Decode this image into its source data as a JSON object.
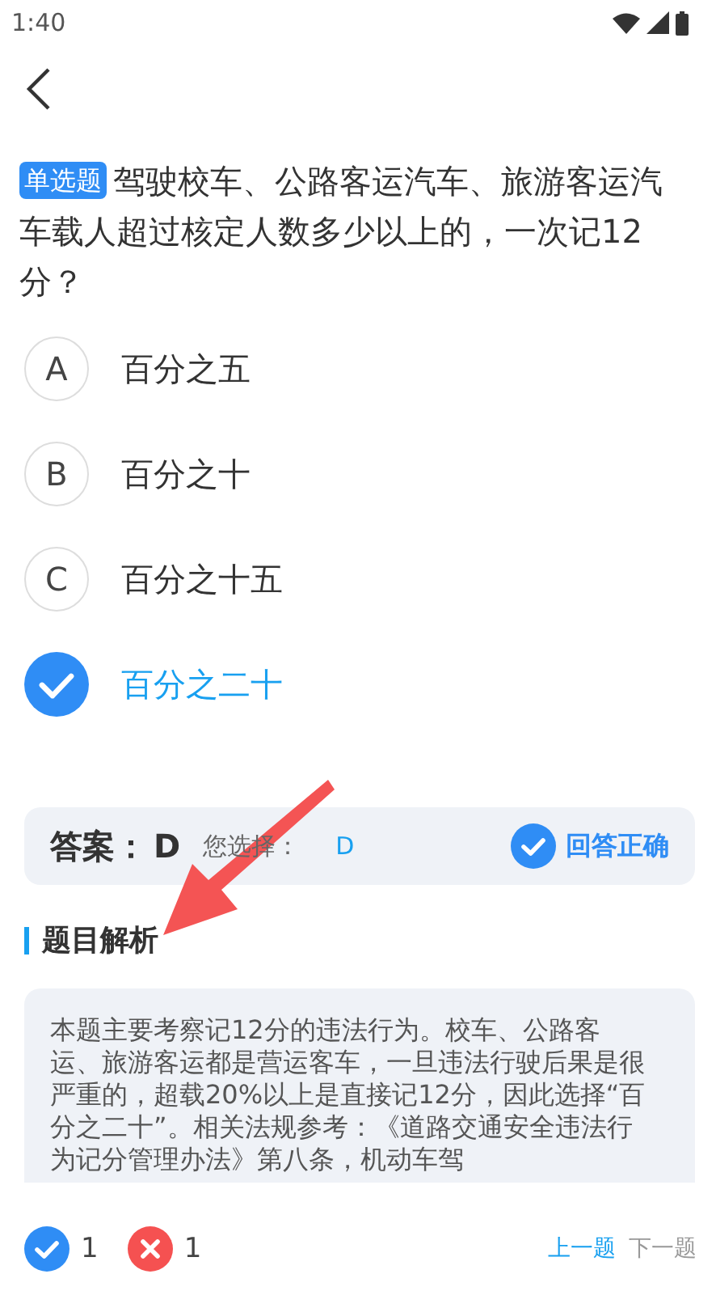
{
  "status_bar": {
    "time": "1:40"
  },
  "question": {
    "type_badge": "单选题",
    "text": "驾驶校车、公路客运汽车、旅游客运汽车载人超过核定人数多少以上的，一次记12分？"
  },
  "options": [
    {
      "letter": "A",
      "text": "百分之五",
      "selected": false
    },
    {
      "letter": "B",
      "text": "百分之十",
      "selected": false
    },
    {
      "letter": "C",
      "text": "百分之十五",
      "selected": false
    },
    {
      "text": "百分之二十",
      "selected": true
    }
  ],
  "answer": {
    "label": "答案：",
    "value": "D",
    "your_choice_label": "您选择：",
    "your_choice": "D",
    "correct": true,
    "result": "回答正确"
  },
  "analysis": {
    "title": "题目解析",
    "text": "本题主要考察记12分的违法行为。校车、公路客运、旅游客运都是营运客车，一旦违法行驶后果是很严重的，超载20%以上是直接记12分，因此选择“百分之二十”。相关法规参考：《道路交通安全违法行为记分管理办法》第八条，机动车驾"
  },
  "footer": {
    "correct_count": "1",
    "wrong_count": "1",
    "prev": {
      "label": "上一题",
      "disabled": false
    },
    "next": {
      "label": "下一题",
      "disabled": true
    }
  }
}
